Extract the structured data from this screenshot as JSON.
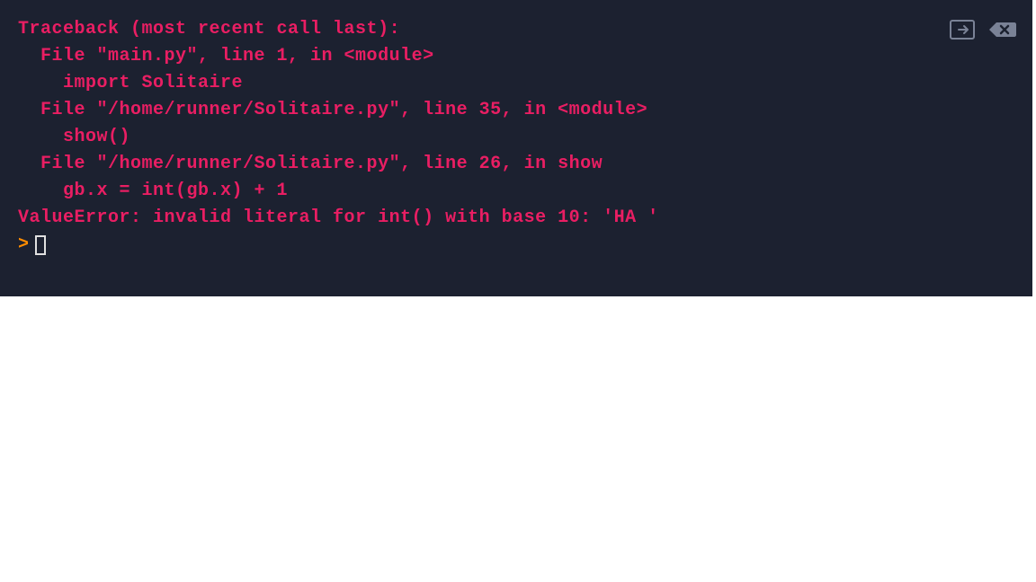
{
  "terminal": {
    "lines": [
      "Traceback (most recent call last):",
      "  File \"main.py\", line 1, in <module>",
      "    import Solitaire",
      "  File \"/home/runner/Solitaire.py\", line 35, in <module>",
      "    show()",
      "  File \"/home/runner/Solitaire.py\", line 26, in show",
      "    gb.x = int(gb.x) + 1",
      "ValueError: invalid literal for int() with base 10: 'HA '"
    ],
    "prompt": ">"
  },
  "colors": {
    "background": "#1c2130",
    "error_text": "#e91e63",
    "prompt": "#ff8c00",
    "icon": "#7a8296"
  }
}
